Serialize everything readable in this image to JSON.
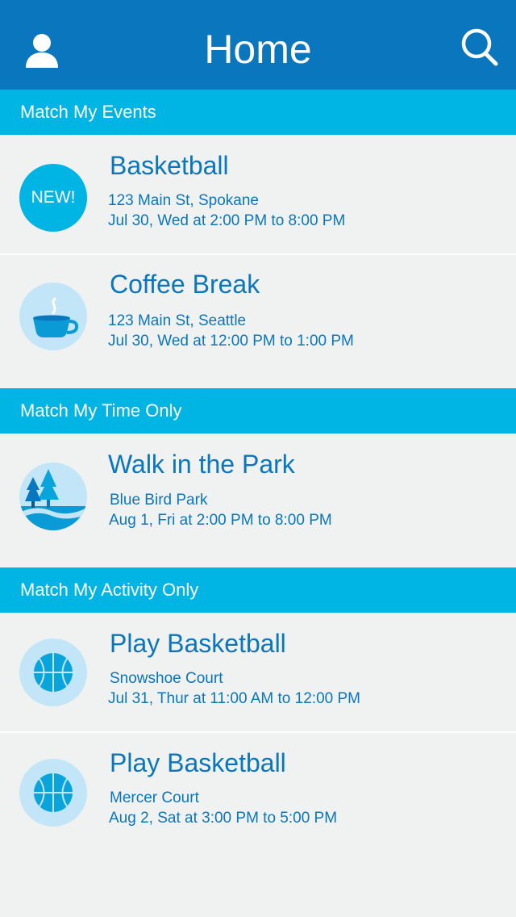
{
  "header": {
    "title": "Home",
    "profile_icon": "user-icon",
    "search_icon": "search-icon"
  },
  "sections": [
    {
      "label": "Match My Events",
      "events": [
        {
          "badge": "NEW!",
          "icon": "new-badge",
          "title": "Basketball",
          "location": "123 Main St, Spokane",
          "time": "Jul 30, Wed at 2:00 PM to 8:00 PM"
        },
        {
          "icon": "coffee-cup-icon",
          "title": "Coffee Break",
          "location": "123 Main St, Seattle",
          "time": "Jul 30, Wed at 12:00 PM to 1:00 PM"
        }
      ]
    },
    {
      "label": "Match My Time Only",
      "events": [
        {
          "icon": "park-trees-icon",
          "title": "Walk in the Park",
          "location": "Blue Bird Park",
          "time": "Aug 1, Fri at 2:00 PM to 8:00 PM"
        }
      ]
    },
    {
      "label": "Match My Activity Only",
      "events": [
        {
          "icon": "basketball-icon",
          "title": "Play Basketball",
          "location": "Snowshoe Court",
          "time": "Jul 31, Thur at 11:00 AM to 12:00 PM"
        },
        {
          "icon": "basketball-icon",
          "title": "Play Basketball",
          "location": "Mercer Court",
          "time": "Aug 2, Sat at 3:00 PM to 5:00 PM"
        }
      ]
    }
  ],
  "colors": {
    "header": "#0a76bd",
    "section_bar": "#00b4e3",
    "background": "#f0f1f1",
    "icon_circle": "#c2e6f8",
    "text": "#0a76bd"
  }
}
